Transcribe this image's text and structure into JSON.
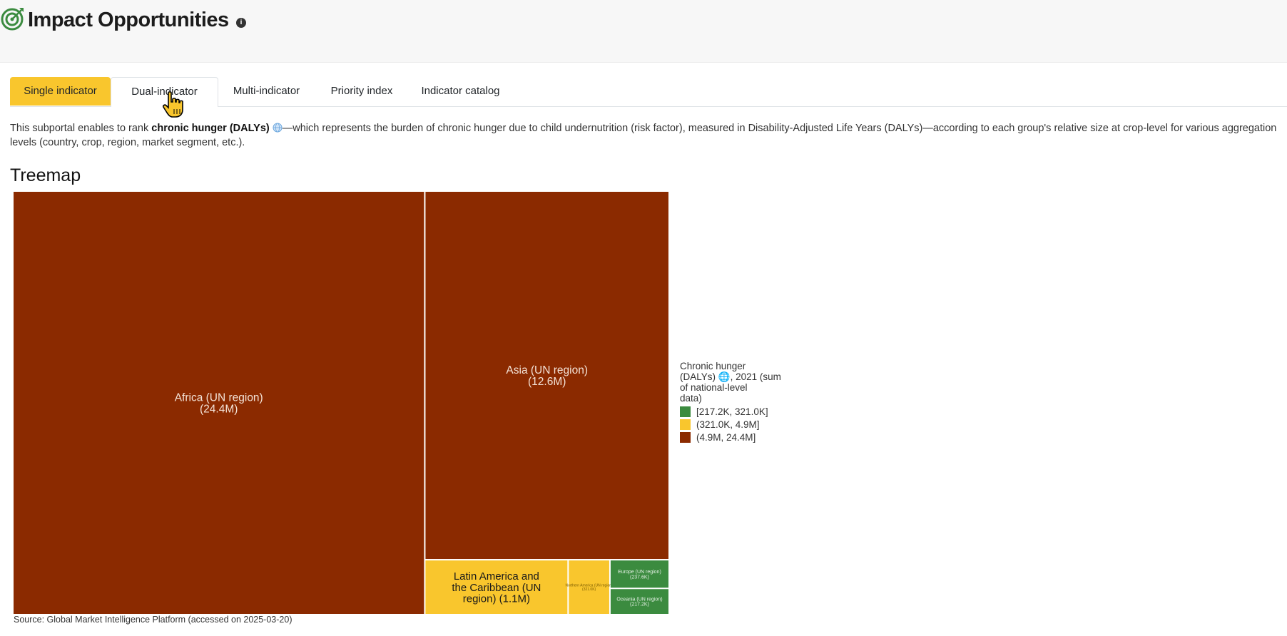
{
  "header": {
    "title": "Impact Opportunities",
    "info_icon": "info-icon",
    "logo_icon": "target-icon",
    "info_glyph": "i"
  },
  "tabs": [
    {
      "label": "Single indicator",
      "active": true
    },
    {
      "label": "Dual-indicator",
      "active": false
    },
    {
      "label": "Multi-indicator",
      "active": false
    },
    {
      "label": "Priority index",
      "active": false
    },
    {
      "label": "Indicator catalog",
      "active": false
    }
  ],
  "description": {
    "prefix": "This subportal enables to rank ",
    "indicator": "chronic hunger (DALYs)",
    "globe_icon": "globe-icon",
    "suffix": "—which represents the burden of chronic hunger due to child undernutrition (risk factor), measured in Disability-Adjusted Life Years (DALYs)—according to each group's relative size at crop-level for various aggregation levels (country, crop, region, market segment, etc.)."
  },
  "section_title": "Treemap",
  "chart_data": {
    "type": "treemap",
    "items": [
      {
        "label": "Africa (UN region)",
        "value_label": "(24.4M)",
        "value": 24400000,
        "color": "#8b2a00"
      },
      {
        "label": "Asia (UN region)",
        "value_label": "(12.6M)",
        "value": 12600000,
        "color": "#8b2a00"
      },
      {
        "label": "Latin America and the Caribbean (UN region)",
        "value_label": "(1.1M)",
        "value": 1100000,
        "color": "#f9c62d"
      },
      {
        "label": "Northern America (UN region)",
        "value_label": "(321.0K)",
        "value": 321000,
        "color": "#f9c62d"
      },
      {
        "label": "Europe (UN region)",
        "value_label": "(237.6K)",
        "value": 237600,
        "color": "#3b8b3f"
      },
      {
        "label": "Oceania (UN region)",
        "value_label": "(217.2K)",
        "value": 217200,
        "color": "#3b8b3f"
      }
    ],
    "legend": {
      "title": [
        "Chronic hunger",
        "(DALYs) 🌐, 2021 (sum",
        "of national-level",
        "data)"
      ],
      "items": [
        {
          "label": "[217.2K, 321.0K]",
          "color": "#3b8b3f"
        },
        {
          "label": "(321.0K, 4.9M]",
          "color": "#f9c62d"
        },
        {
          "label": "(4.9M, 24.4M]",
          "color": "#8b2a00"
        }
      ]
    }
  },
  "source": "Source: Global Market Intelligence Platform (accessed on 2025-03-20)"
}
